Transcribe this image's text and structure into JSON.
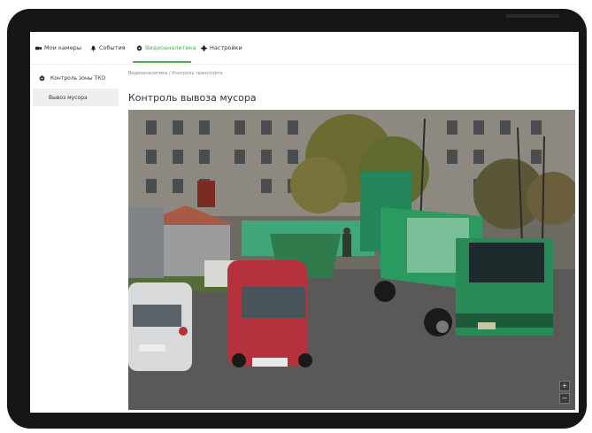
{
  "nav": {
    "items": [
      {
        "label": "Мои камеры",
        "icon": "camera-icon",
        "active": false
      },
      {
        "label": "События",
        "icon": "bell-icon",
        "active": false
      },
      {
        "label": "Видеоаналитика",
        "icon": "analytics-icon",
        "active": true
      },
      {
        "label": "Настройки",
        "icon": "gear-icon",
        "active": false
      }
    ],
    "active_color": "#4caf50"
  },
  "sidebar": {
    "header": "Контроль зоны ТКО",
    "items": [
      {
        "label": "Вывоз мусора",
        "selected": true
      }
    ]
  },
  "breadcrumb": "Видеоаналитика / Контроль транспорта",
  "page_title": "Контроль вывоза мусора",
  "video": {
    "controls": [
      "+",
      "−"
    ]
  }
}
